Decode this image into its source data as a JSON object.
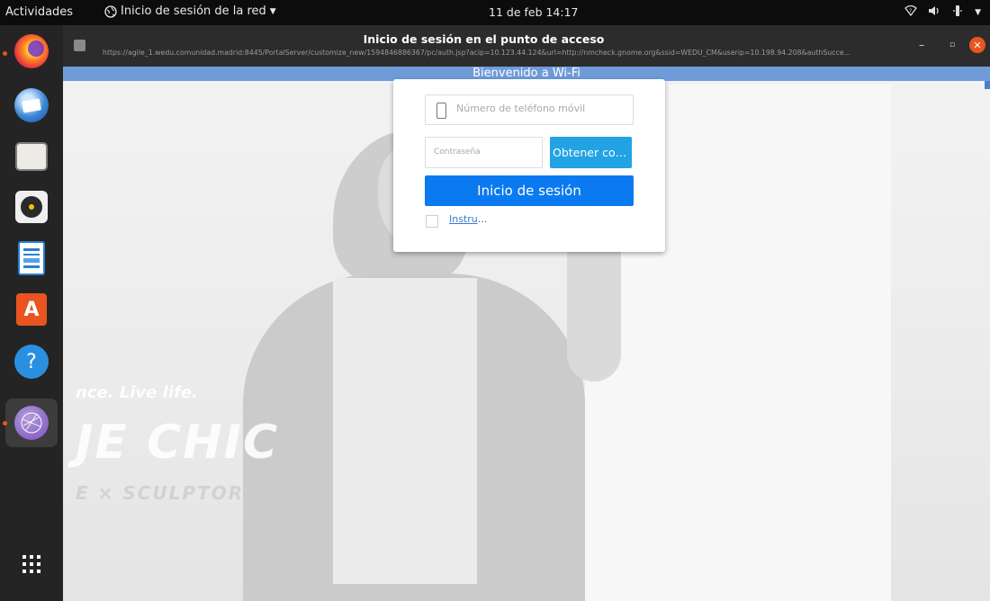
{
  "topbar": {
    "activities": "Actividades",
    "network_menu": "Inicio de sesión de la red",
    "clock": "11 de feb  14:17"
  },
  "dock": {
    "apps": [
      "Firefox",
      "Thunderbird",
      "Archivos",
      "Rhythmbox",
      "LibreOffice Writer",
      "Ubuntu Software",
      "Ayuda",
      "Inicio de sesión de la red"
    ],
    "show_apps": "Mostrar aplicaciones"
  },
  "window": {
    "title": "Inicio de sesión en el punto de acceso",
    "url": "https://agile_1.wedu.comunidad.madrid:8445/PortalServer/customize_new/1594846886367/pc/auth.jsp?acip=10.123.44.124&url=http://nmcheck.gnome.org&ssid=WEDU_CM&userip=10.198.94.208&authSucce..."
  },
  "page": {
    "banner": "Bienvenido a Wi-Fi",
    "bg_text_1": "nce. Live life.",
    "bg_text_2": "JE CHIC",
    "bg_text_3": "E × SCULPTOR"
  },
  "login": {
    "phone_placeholder": "Número de teléfono móvil",
    "password_placeholder": "Contraseña",
    "get_code": "Obtener con…",
    "submit": "Inicio de sesión",
    "instructions_link": "Instru",
    "instructions_suffix": "..."
  },
  "colors": {
    "banner": "#6f9cd9",
    "login_button": "#0b7af0",
    "code_button": "#21a3e4",
    "close_button": "#e95420"
  }
}
